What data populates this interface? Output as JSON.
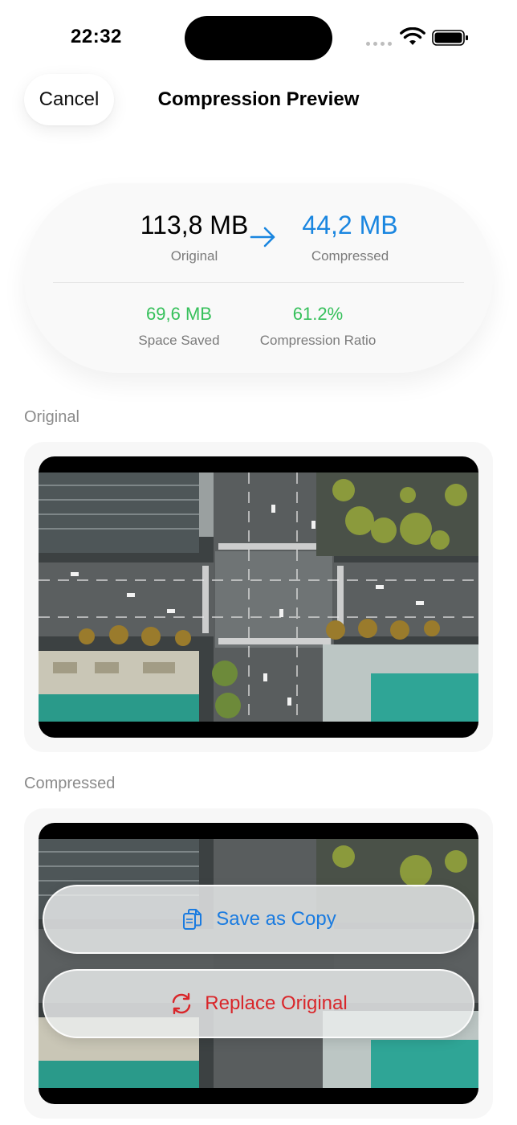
{
  "status_bar": {
    "time": "22:32"
  },
  "header": {
    "cancel_label": "Cancel",
    "title": "Compression Preview"
  },
  "summary": {
    "original_size": "113,8 MB",
    "original_label": "Original",
    "compressed_size": "44,2 MB",
    "compressed_label": "Compressed",
    "space_saved_value": "69,6 MB",
    "space_saved_label": "Space Saved",
    "ratio_value": "61.2%",
    "ratio_label": "Compression Ratio"
  },
  "sections": {
    "original_label": "Original",
    "compressed_label": "Compressed"
  },
  "actions": {
    "save_copy_label": "Save as Copy",
    "replace_label": "Replace Original"
  },
  "colors": {
    "accent_blue": "#1a86e0",
    "saved_green": "#36c05b",
    "destructive_red": "#d9262a"
  },
  "icons": [
    "wifi-icon",
    "battery-icon",
    "arrow-right-icon",
    "document-copy-icon",
    "refresh-icon"
  ]
}
